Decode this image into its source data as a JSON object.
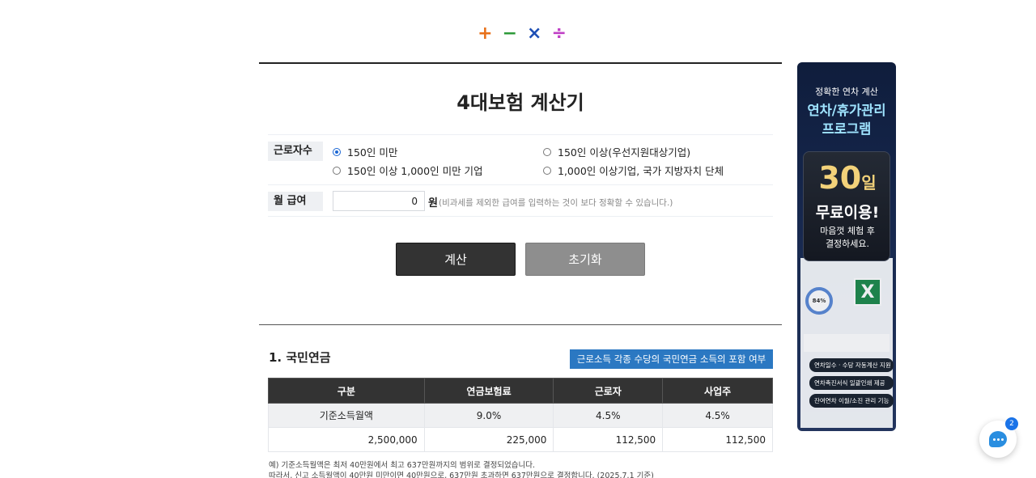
{
  "logo": {
    "symbols": [
      "+",
      "−",
      "×",
      "÷"
    ],
    "colors": [
      "#e8711a",
      "#2f9a3a",
      "#1e4fb5",
      "#c03fc6"
    ]
  },
  "calculator": {
    "title": "4대보험 계산기",
    "workers_label": "근로자수",
    "workers_options": [
      {
        "label": "150인 미만",
        "selected": true
      },
      {
        "label": "150인 이상(우선지원대상기업)",
        "selected": false
      },
      {
        "label": "150인 이상 1,000인 미만 기업",
        "selected": false
      },
      {
        "label": "1,000인 이상기업, 국가 지방자치 단체",
        "selected": false
      }
    ],
    "salary_label": "월 급여",
    "salary_value": "0",
    "salary_unit": "원",
    "salary_hint": "(비과세를 제외한 급여를 입력하는 것이 보다 정확할 수 있습니다.)",
    "calc_button": "계산",
    "reset_button": "초기화"
  },
  "pension": {
    "section_title": "1. 국민연금",
    "link_label": "근로소득 각종 수당의 국민연금 소득의 포함 여부",
    "headers": [
      "구분",
      "연금보험료",
      "근로자",
      "사업주"
    ],
    "rate_row": [
      "기준소득월액",
      "9.0%",
      "4.5%",
      "4.5%"
    ],
    "amount_row": [
      "2,500,000",
      "225,000",
      "112,500",
      "112,500"
    ],
    "note_1": "예) 기준소득월액은 최저 40만원에서 최고 637만원까지의 범위로 결정되었습니다.",
    "note_2": "따라서, 신고 소득월액이 40만원 미만이면 40만원으로, 637만원 초과하면 637만원으로 결정합니다. (2025.7.1 기준)"
  },
  "ad": {
    "subtitle": "정확한 연차 계산",
    "title_line1": "연차/휴가관리",
    "title_line2": "프로그램",
    "days": "30",
    "days_unit": "일",
    "free": "무료이용!",
    "desc_line1": "마음껏 체험 후",
    "desc_line2": "결정하세요.",
    "donut_value": "84%",
    "excel_letter": "X",
    "features": [
      "연차일수 · 수당 자동계산 지원",
      "연차촉진서식 일괄인쇄 제공",
      "잔여연차 이월/소진 관리 기능"
    ]
  },
  "chat": {
    "badge_count": "2"
  }
}
